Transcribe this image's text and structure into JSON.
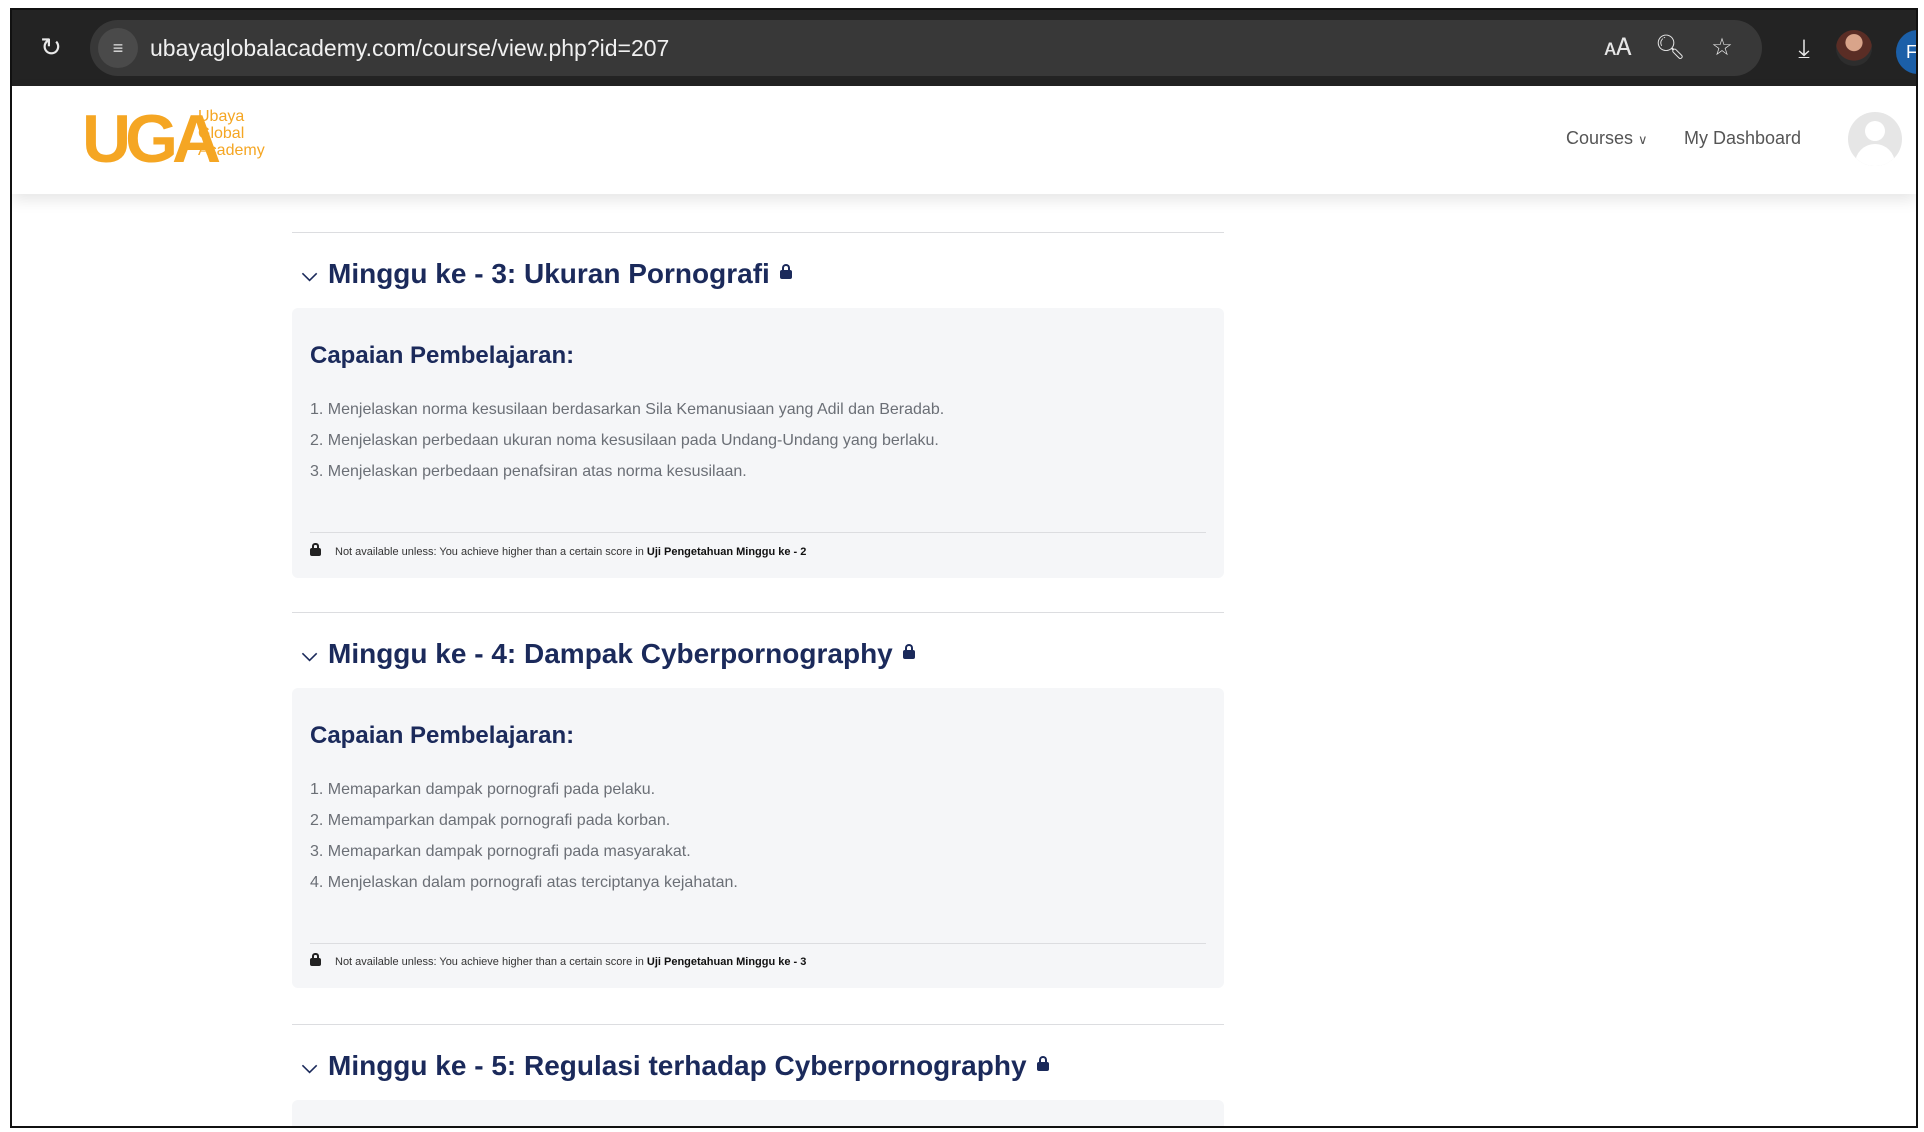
{
  "browser": {
    "url": "ubayaglobalacademy.com/course/view.php?id=207",
    "account_initial": "F"
  },
  "header": {
    "logo_mark": "UGA",
    "logo_lines": [
      "Ubaya",
      "Global",
      "Academy"
    ],
    "nav_courses": "Courses",
    "nav_dashboard": "My Dashboard"
  },
  "sections": [
    {
      "title": "Minggu ke - 3: Ukuran Pornografi",
      "summary_heading": "Capaian Pembelajaran:",
      "outcomes": [
        "1. Menjelaskan norma kesusilaan berdasarkan Sila Kemanusiaan yang Adil dan Beradab.",
        "2. Menjelaskan perbedaan ukuran noma kesusilaan pada Undang-Undang yang berlaku.",
        "3. Menjelaskan perbedaan penafsiran atas norma kesusilaan."
      ],
      "restriction_text": "Not available unless: You achieve higher than a certain score in",
      "restriction_target": "Uji Pengetahuan Minggu ke - 2"
    },
    {
      "title": "Minggu ke - 4: Dampak Cyberpornography",
      "summary_heading": "Capaian Pembelajaran:",
      "outcomes": [
        "1. Memaparkan dampak pornografi pada pelaku.",
        "2. Memamparkan dampak pornografi pada korban.",
        "3. Memaparkan dampak pornografi pada masyarakat.",
        "4. Menjelaskan dalam pornografi atas terciptanya kejahatan."
      ],
      "restriction_text": "Not available unless: You achieve higher than a certain score in",
      "restriction_target": "Uji Pengetahuan Minggu ke - 3"
    },
    {
      "title": "Minggu ke - 5: Regulasi terhadap Cyberpornography"
    }
  ]
}
